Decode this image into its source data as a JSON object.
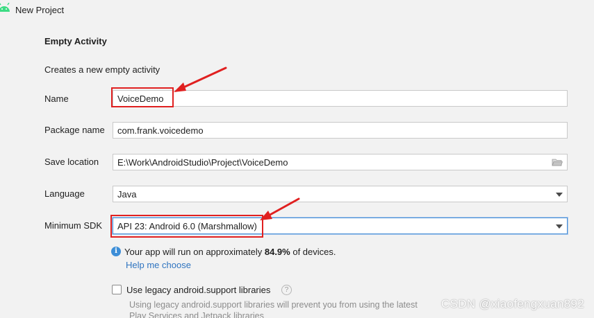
{
  "window": {
    "title": "New Project"
  },
  "template": {
    "heading": "Empty Activity",
    "description": "Creates a new empty activity"
  },
  "form": {
    "name": {
      "label": "Name",
      "value": "VoiceDemo"
    },
    "package": {
      "label": "Package name",
      "value": "com.frank.voicedemo"
    },
    "save_location": {
      "label": "Save location",
      "value": "E:\\Work\\AndroidStudio\\Project\\VoiceDemo"
    },
    "language": {
      "label": "Language",
      "value": "Java"
    },
    "min_sdk": {
      "label": "Minimum SDK",
      "value": "API 23: Android 6.0 (Marshmallow)"
    }
  },
  "info": {
    "prefix": "Your app will run on approximately ",
    "percent": "84.9%",
    "suffix": " of devices.",
    "help_link": "Help me choose"
  },
  "legacy": {
    "checkbox_label": "Use legacy android.support libraries",
    "checked": false,
    "help_symbol": "?",
    "hint": "Using legacy android.support libraries will prevent you from using the latest Play Services and Jetpack libraries"
  },
  "watermark": "CSDN @xiaofengxuan892",
  "colors": {
    "background": "#f2f2f2",
    "annotation": "#e02020",
    "link": "#2f74c0",
    "info": "#3d8ed8",
    "android_green": "#3ddc84"
  },
  "icons": {
    "title": "android-icon",
    "browse": "folder-icon",
    "dropdown": "chevron-down-icon",
    "info": "info-icon",
    "help": "question-icon"
  }
}
